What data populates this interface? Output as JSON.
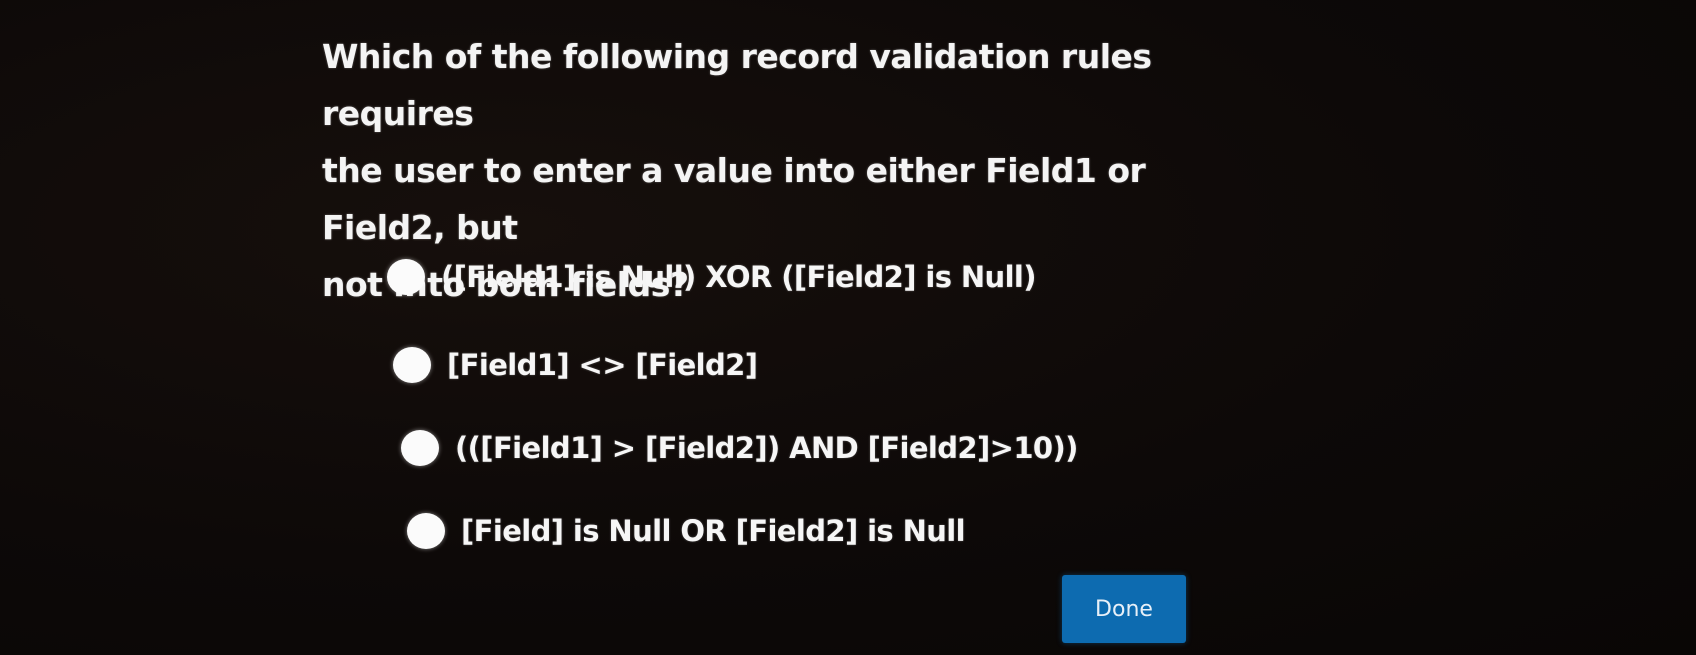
{
  "question": {
    "lines": [
      "Which of the following record validation rules requires",
      "the user to enter a value into either Field1 or Field2, but",
      "not into both fields?"
    ]
  },
  "options": [
    {
      "label": "([Field1] is Null) XOR ([Field2] is Null)"
    },
    {
      "label": "[Field1] <> [Field2]"
    },
    {
      "label": "(([Field1] > [Field2]) AND [Field2]>10))"
    },
    {
      "label": "[Field] is Null OR [Field2] is Null"
    }
  ],
  "actions": {
    "done_label": "Done"
  },
  "colors": {
    "background": "#0c0807",
    "text": "#f4f4f4",
    "radio": "#fbfbfb",
    "button": "#0d6bb0"
  }
}
